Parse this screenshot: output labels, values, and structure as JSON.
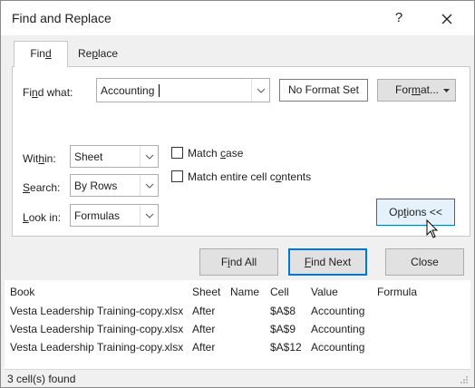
{
  "window": {
    "title": "Find and Replace",
    "help_label": "?",
    "close_icon": "close-icon"
  },
  "tabs": [
    {
      "label": "Find",
      "underline_index": 2,
      "active": true
    },
    {
      "label": "Replace",
      "underline_index": 2,
      "active": false
    }
  ],
  "find_what": {
    "label": "Find what:",
    "value": "Accounting",
    "no_format_label": "No Format Set",
    "format_label": "Format..."
  },
  "within": {
    "label": "Within:",
    "value": "Sheet"
  },
  "search": {
    "label": "Search:",
    "value": "By Rows"
  },
  "look_in": {
    "label": "Look in:",
    "value": "Formulas"
  },
  "match_case": {
    "label": "Match case",
    "checked": false
  },
  "match_entire": {
    "label": "Match entire cell contents",
    "checked": false
  },
  "options_label": "Options <<",
  "buttons": {
    "find_all": "Find All",
    "find_next": "Find Next",
    "close": "Close"
  },
  "results": {
    "headers": [
      "Book",
      "Sheet",
      "Name",
      "Cell",
      "Value",
      "Formula"
    ],
    "rows": [
      [
        "Vesta Leadership Training-copy.xlsx",
        "After",
        "",
        "$A$8",
        "Accounting",
        ""
      ],
      [
        "Vesta Leadership Training-copy.xlsx",
        "After",
        "",
        "$A$9",
        "Accounting",
        ""
      ],
      [
        "Vesta Leadership Training-copy.xlsx",
        "After",
        "",
        "$A$12",
        "Accounting",
        ""
      ]
    ]
  },
  "status": "3 cell(s) found",
  "colors": {
    "accent": "#0078d7",
    "face": "#f0f0f0",
    "button": "#e1e1e1"
  }
}
